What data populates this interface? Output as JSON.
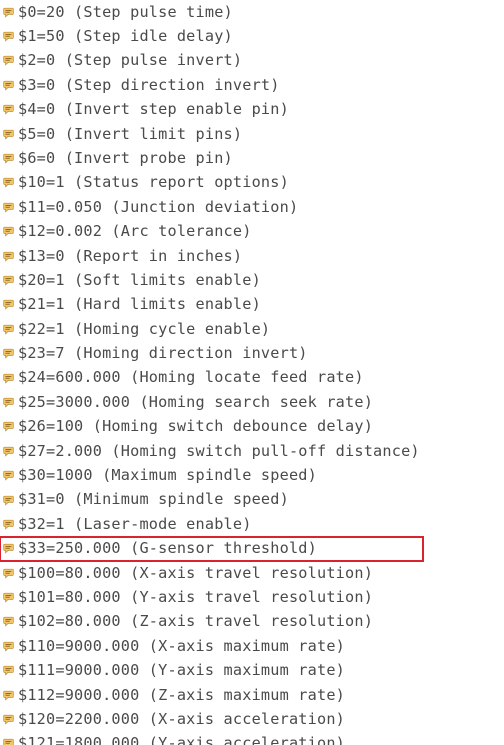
{
  "console": {
    "accent_color": "#d9232e",
    "icon_name": "message-icon",
    "lines": [
      {
        "text": "$0=20 (Step pulse time)"
      },
      {
        "text": "$1=50 (Step idle delay)"
      },
      {
        "text": "$2=0 (Step pulse invert)"
      },
      {
        "text": "$3=0 (Step direction invert)"
      },
      {
        "text": "$4=0 (Invert step enable pin)"
      },
      {
        "text": "$5=0 (Invert limit pins)"
      },
      {
        "text": "$6=0 (Invert probe pin)"
      },
      {
        "text": "$10=1 (Status report options)"
      },
      {
        "text": "$11=0.050 (Junction deviation)"
      },
      {
        "text": "$12=0.002 (Arc tolerance)"
      },
      {
        "text": "$13=0 (Report in inches)"
      },
      {
        "text": "$20=1 (Soft limits enable)"
      },
      {
        "text": "$21=1 (Hard limits enable)"
      },
      {
        "text": "$22=1 (Homing cycle enable)"
      },
      {
        "text": "$23=7 (Homing direction invert)"
      },
      {
        "text": "$24=600.000 (Homing locate feed rate)"
      },
      {
        "text": "$25=3000.000 (Homing search seek rate)"
      },
      {
        "text": "$26=100 (Homing switch debounce delay)"
      },
      {
        "text": "$27=2.000 (Homing switch pull-off distance)"
      },
      {
        "text": "$30=1000 (Maximum spindle speed)"
      },
      {
        "text": "$31=0 (Minimum spindle speed)"
      },
      {
        "text": "$32=1 (Laser-mode enable)"
      },
      {
        "text": "$33=250.000 (G-sensor threshold)",
        "highlighted": true
      },
      {
        "text": "$100=80.000 (X-axis travel resolution)"
      },
      {
        "text": "$101=80.000 (Y-axis travel resolution)"
      },
      {
        "text": "$102=80.000 (Z-axis travel resolution)"
      },
      {
        "text": "$110=9000.000 (X-axis maximum rate)"
      },
      {
        "text": "$111=9000.000 (Y-axis maximum rate)"
      },
      {
        "text": "$112=9000.000 (Z-axis maximum rate)"
      },
      {
        "text": "$120=2200.000 (X-axis acceleration)"
      },
      {
        "text": "$121=1800.000 (Y-axis acceleration)"
      }
    ]
  }
}
